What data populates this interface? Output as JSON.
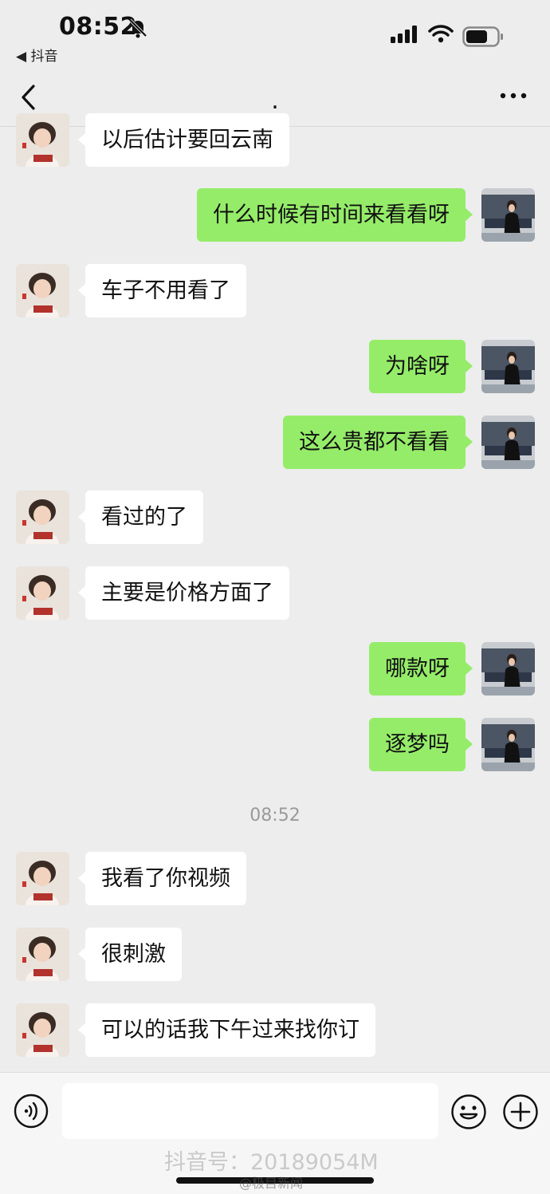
{
  "status_bar": {
    "time": "08:52",
    "back_app_label": "◀ 抖音",
    "mute_icon": "bell-slash-icon",
    "signal_icon": "signal-bars-icon",
    "wifi_icon": "wifi-icon",
    "battery_icon": "battery-icon"
  },
  "nav": {
    "title": ".",
    "back_icon": "chevron-left-icon",
    "more_icon": "ellipsis-icon"
  },
  "messages": [
    {
      "side": "left",
      "text": "以后估计要回云南"
    },
    {
      "side": "right",
      "text": "什么时候有时间来看看呀"
    },
    {
      "side": "left",
      "text": "车子不用看了"
    },
    {
      "side": "right",
      "text": "为啥呀"
    },
    {
      "side": "right",
      "text": "这么贵都不看看"
    },
    {
      "side": "left",
      "text": "看过的了"
    },
    {
      "side": "left",
      "text": "主要是价格方面了"
    },
    {
      "side": "right",
      "text": "哪款呀"
    },
    {
      "side": "right",
      "text": "逐梦吗"
    },
    {
      "side": "left",
      "text": "我看了你视频"
    },
    {
      "side": "left",
      "text": "很刺激"
    },
    {
      "side": "left",
      "text": "可以的话我下午过来找你订"
    }
  ],
  "timestamp": "08:52",
  "input_bar": {
    "placeholder": "",
    "voice_icon": "voice-icon",
    "emoji_icon": "smiley-icon",
    "plus_icon": "plus-circle-icon"
  },
  "watermark": {
    "main": "抖音号：20189054M",
    "sub": "@极目新闻"
  },
  "colors": {
    "background": "#ededed",
    "sent_bubble": "#95ec69",
    "received_bubble": "#ffffff"
  }
}
